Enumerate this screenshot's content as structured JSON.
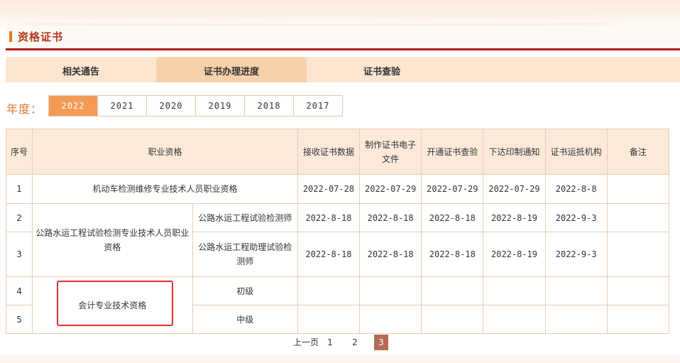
{
  "section": {
    "title": "资格证书"
  },
  "tabs": [
    {
      "label": "相关通告"
    },
    {
      "label": "证书办理进度"
    },
    {
      "label": "证书查验"
    }
  ],
  "year_filter": {
    "label": "年度：",
    "years": [
      "2022",
      "2021",
      "2020",
      "2019",
      "2018",
      "2017"
    ],
    "selected": "2022"
  },
  "table": {
    "headers": [
      "序号",
      "职业资格",
      "接收证书数据",
      "制作证书电子文件",
      "开通证书查验",
      "下达印制通知",
      "证书运抵机构",
      "备注"
    ],
    "rows": [
      {
        "no": "1",
        "qual": "机动车检测维修专业技术人员职业资格",
        "sub": "",
        "dates": [
          "2022-07-28",
          "2022-07-29",
          "2022-07-29",
          "2022-07-29",
          "2022-8-8"
        ],
        "note": ""
      },
      {
        "no": "2",
        "qual": "公路水运工程试验检测专业技术人员职业资格",
        "sub": "公路水运工程试验检测师",
        "dates": [
          "2022-8-18",
          "2022-8-18",
          "2022-8-18",
          "2022-8-19",
          "2022-9-3"
        ],
        "note": ""
      },
      {
        "no": "3",
        "qual": "",
        "sub": "公路水运工程助理试验检测师",
        "dates": [
          "2022-8-18",
          "2022-8-18",
          "2022-8-18",
          "2022-8-19",
          "2022-9-3"
        ],
        "note": ""
      },
      {
        "no": "4",
        "qual": "会计专业技术资格",
        "sub": "初级",
        "dates": [
          "",
          "",
          "",
          "",
          ""
        ],
        "note": ""
      },
      {
        "no": "5",
        "qual": "",
        "sub": "中级",
        "dates": [
          "",
          "",
          "",
          "",
          ""
        ],
        "note": ""
      }
    ]
  },
  "pager": {
    "prev": "上一页",
    "pages": [
      "1",
      "2",
      "3"
    ],
    "current": "3"
  },
  "colors": {
    "accent": "#f39a55",
    "title_red": "#b23a1c",
    "rule_red": "#b01b14",
    "highlight_box": "#e03030"
  }
}
